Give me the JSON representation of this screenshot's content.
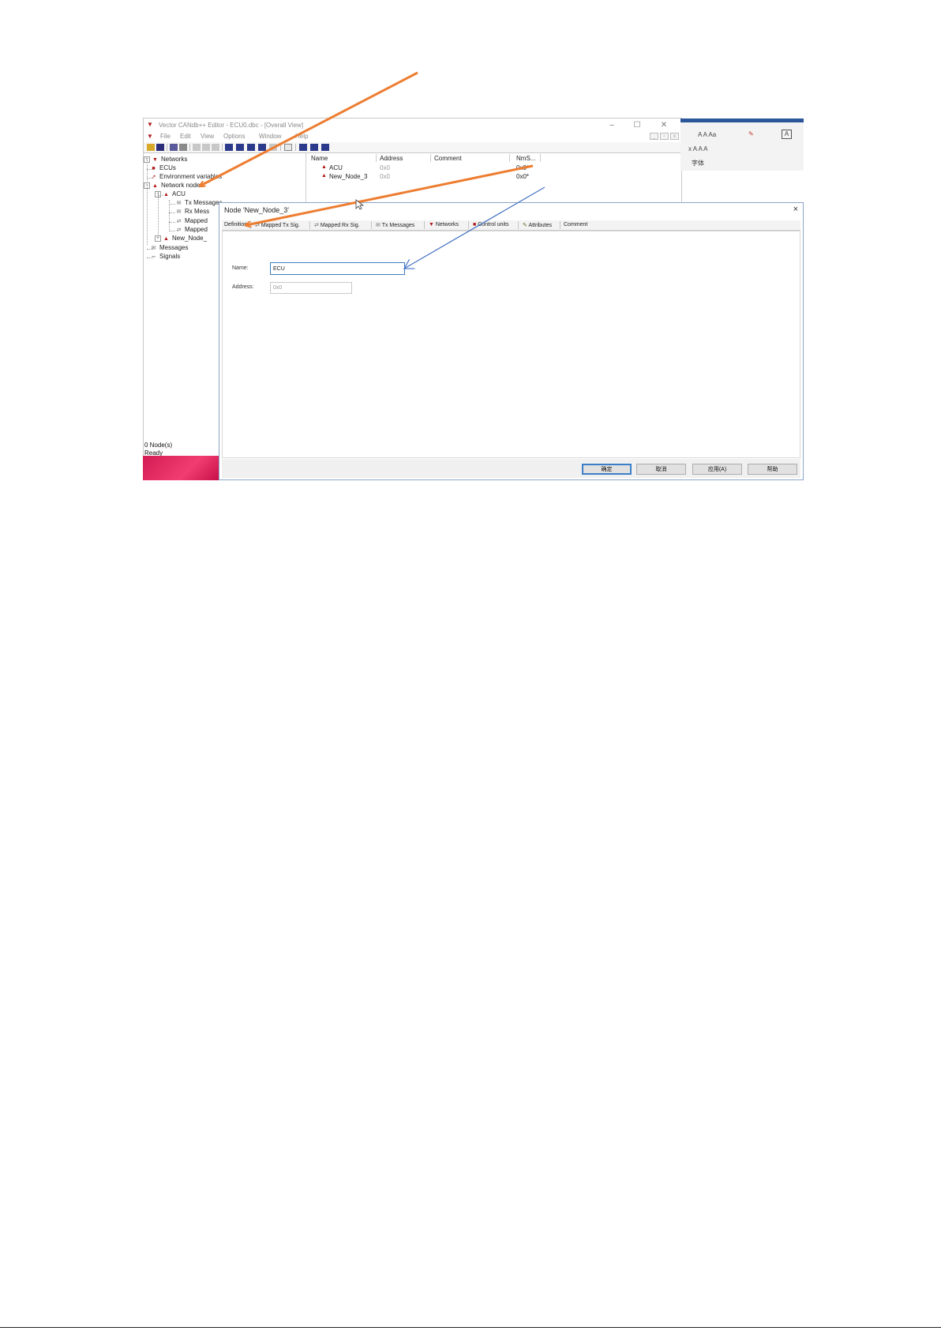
{
  "app": {
    "title": "Vector CANdb++ Editor - ECU0.dbc - [Overall View]",
    "menu": [
      "File",
      "Edit",
      "View",
      "Options",
      "Window",
      "Help"
    ],
    "toolbar_icons": [
      "open-icon",
      "save-icon",
      "copy-icon",
      "paste-icon",
      "new-node-icon",
      "delete-icon",
      "find-icon",
      "overview-icon",
      "network-icon",
      "node-icon",
      "message-icon",
      "signal-icon",
      "dbc-icon",
      "cascade-icon",
      "tile-h-icon",
      "tile-v-icon"
    ]
  },
  "tree": {
    "networks": "Networks",
    "ecus": "ECUs",
    "env_vars": "Environment variables",
    "network_nodes": "Network nodes",
    "acu": "ACU",
    "tx_messages": "Tx Messages",
    "rx_messages": "Rx Mess",
    "mapped_tx": "Mapped",
    "mapped_rx": "Mapped",
    "new_node": "New_Node_",
    "messages": "Messages",
    "signals": "Signals"
  },
  "listview": {
    "columns": [
      "Name",
      "Address",
      "Comment",
      "NmS..."
    ],
    "rows": [
      {
        "name": "ACU",
        "address": "0x0",
        "comment": "",
        "nm": "0x0*"
      },
      {
        "name": "New_Node_3",
        "address": "0x0",
        "comment": "",
        "nm": "0x0*"
      }
    ]
  },
  "status": {
    "count": "0 Node(s)",
    "state": "Ready"
  },
  "ribbon": {
    "group_label": "字体",
    "row1": "A  A   Aa  ",
    "row2": "x   A   A   A"
  },
  "dialog": {
    "title": "Node 'New_Node_3'",
    "close": "×",
    "tabs": [
      "Definition",
      "Mapped Tx Sig.",
      "Mapped Rx Sig.",
      "Tx Messages",
      "Networks",
      "Control units",
      "Attributes",
      "Comment"
    ],
    "fields": {
      "name_label": "Name:",
      "name_value": "ECU",
      "address_label": "Address:",
      "address_value": "0x0"
    },
    "buttons": {
      "ok": "确定",
      "cancel": "取消",
      "apply": "应用(A)",
      "help": "帮助"
    }
  },
  "colors": {
    "arrow_orange": "#ed7d31",
    "arrow_blue": "#4472c4",
    "node_red": "#b01818"
  }
}
